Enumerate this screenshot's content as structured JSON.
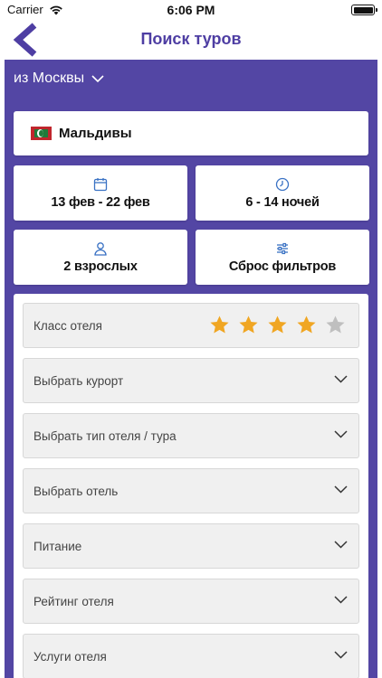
{
  "status_bar": {
    "carrier": "Carrier",
    "time": "6:06 PM"
  },
  "nav": {
    "title": "Поиск туров",
    "back_icon": "chevron-left-icon"
  },
  "departure": {
    "label": "из Москвы",
    "icon": "chevron-down-icon"
  },
  "destination": {
    "label": "Мальдивы",
    "flag": "maldives-flag-icon"
  },
  "dates": {
    "label": "13 фев - 22 фев",
    "icon": "calendar-icon"
  },
  "nights": {
    "label": "6 - 14 ночей",
    "icon": "clock-icon"
  },
  "guests": {
    "label": "2 взрослых",
    "icon": "person-icon"
  },
  "reset": {
    "label": "Сброс фильтров",
    "icon": "sliders-icon"
  },
  "hotel_class": {
    "label": "Класс отеля",
    "rating": 4,
    "max": 5
  },
  "filters": [
    {
      "label": "Выбрать курорт"
    },
    {
      "label": "Выбрать тип отеля / тура"
    },
    {
      "label": "Выбрать отель"
    },
    {
      "label": "Питание"
    },
    {
      "label": "Рейтинг отеля"
    },
    {
      "label": "Услуги отеля"
    }
  ],
  "colors": {
    "accent": "#4e3ea3",
    "panel": "#5346a4",
    "star_active": "#f0a623",
    "star_inactive": "#bfbfbf",
    "icon_blue": "#3a72c4"
  }
}
